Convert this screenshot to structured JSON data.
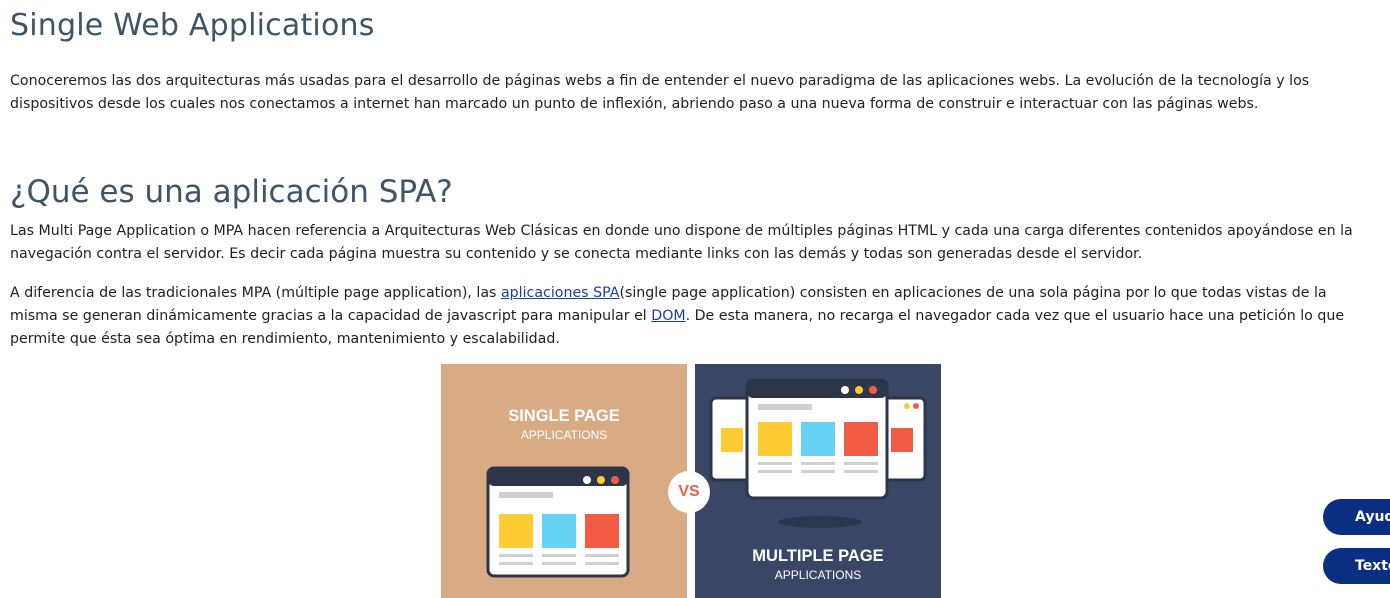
{
  "page": {
    "title": "Single Web Applications",
    "intro": "Conoceremos las dos arquitecturas más usadas para el desarrollo de páginas webs a fin de entender el nuevo paradigma de las aplicaciones webs. La evolución de la tecnología y los dispositivos desde los cuales nos conectamos a internet han marcado un punto de inflexión, abriendo paso a una nueva forma de construir e interactuar con las páginas webs.",
    "section_title": "¿Qué es una aplicación SPA?",
    "mpa_paragraph": "Las Multi Page Application o MPA hacen referencia a Arquitecturas Web Clásicas en donde uno dispone de múltiples páginas HTML y cada una carga diferentes contenidos apoyándose en la navegación contra el servidor. Es decir cada página muestra su contenido y se conecta mediante links con las demás y todas son generadas desde el servidor.",
    "spa_paragraph": {
      "before_link": "A diferencia de las tradicionales MPA (múltiple page application), las ",
      "link1": "aplicaciones SPA",
      "middle": "(single page application) consisten en aplicaciones de una sola página por lo que todas vistas de la misma se generan dinámicamente gracias a la capacidad de javascript para manipular el ",
      "link2": "DOM",
      "after_link": ". De esta manera, no recarga el navegador cada vez que el usuario hace una petición lo que permite que ésta sea óptima en rendimiento, mantenimiento y escalabilidad."
    }
  },
  "figure": {
    "left_heading": "SINGLE PAGE",
    "left_sub": "APPLICATIONS",
    "vs": "VS",
    "right_heading": "MULTIPLE PAGE",
    "right_sub": "APPLICATIONS",
    "colors": {
      "left_bg": "#d9ab85",
      "right_bg": "#394666",
      "yellow": "#ffcc33",
      "blue": "#66d3f5",
      "red": "#f25c45",
      "window_dark": "#2d3548"
    }
  },
  "side_buttons": {
    "help": "Ayuda",
    "text": "Texto a"
  }
}
